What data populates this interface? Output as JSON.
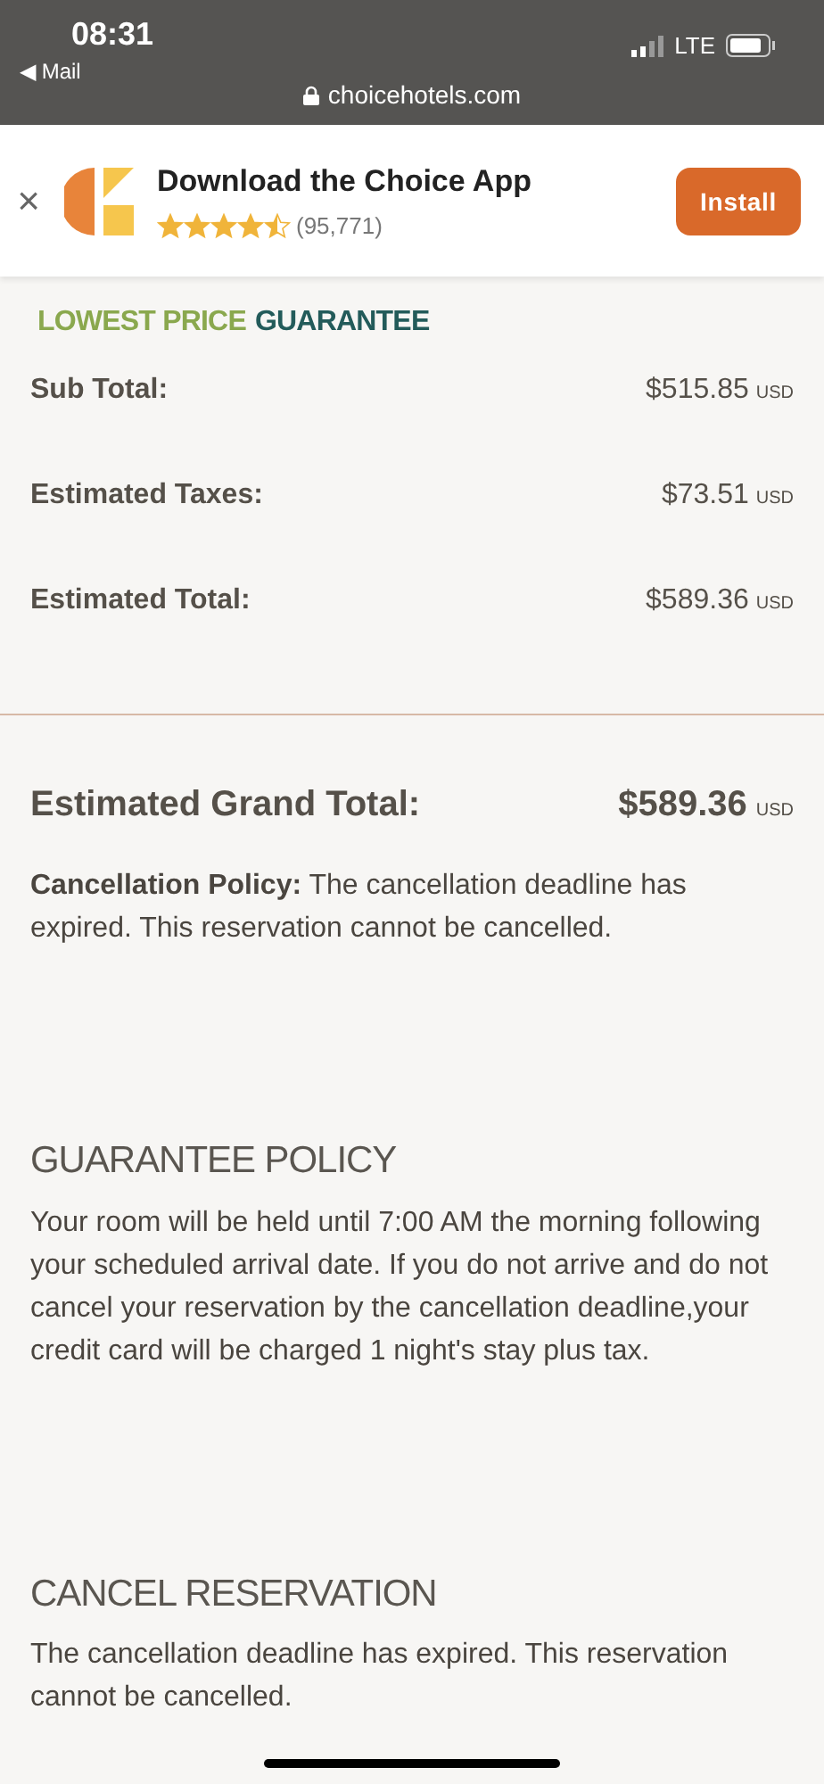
{
  "status_bar": {
    "time": "08:31",
    "back": "◀ Mail",
    "network": "LTE",
    "url": "choicehotels.com"
  },
  "app_banner": {
    "close": "×",
    "title": "Download the Choice App",
    "stars": 4.5,
    "ratings": "(95,771)",
    "button": "Install"
  },
  "badge": {
    "part_1": "LOWEST PRICE",
    "part_2": "GUARANTEE"
  },
  "totals": [
    {
      "label": "Sub Total:",
      "amount": "$515.85",
      "currency": "USD"
    },
    {
      "label": "Estimated Taxes:",
      "amount": "$73.51",
      "currency": "USD"
    },
    {
      "label": "Estimated Total:",
      "amount": "$589.36",
      "currency": "USD"
    }
  ],
  "grand_total": {
    "label": "Estimated Grand Total:",
    "amount": "$589.36",
    "currency": "USD"
  },
  "cancellation_policy": "**Cancellation Policy:** The cancellation deadline has expired. This reservation cannot be cancelled.",
  "sections": [
    {
      "heading": "GUARANTEE POLICY",
      "text": "Your room will be held until 7:00 AM the morning following your scheduled arrival date. If you do not arrive and do not cancel your reservation by the cancellation deadline,your credit card will be charged 1 night's stay plus tax."
    },
    {
      "heading": "CANCEL RESERVATION",
      "text": "The cancellation deadline has expired. This reservation cannot be cancelled."
    }
  ]
}
